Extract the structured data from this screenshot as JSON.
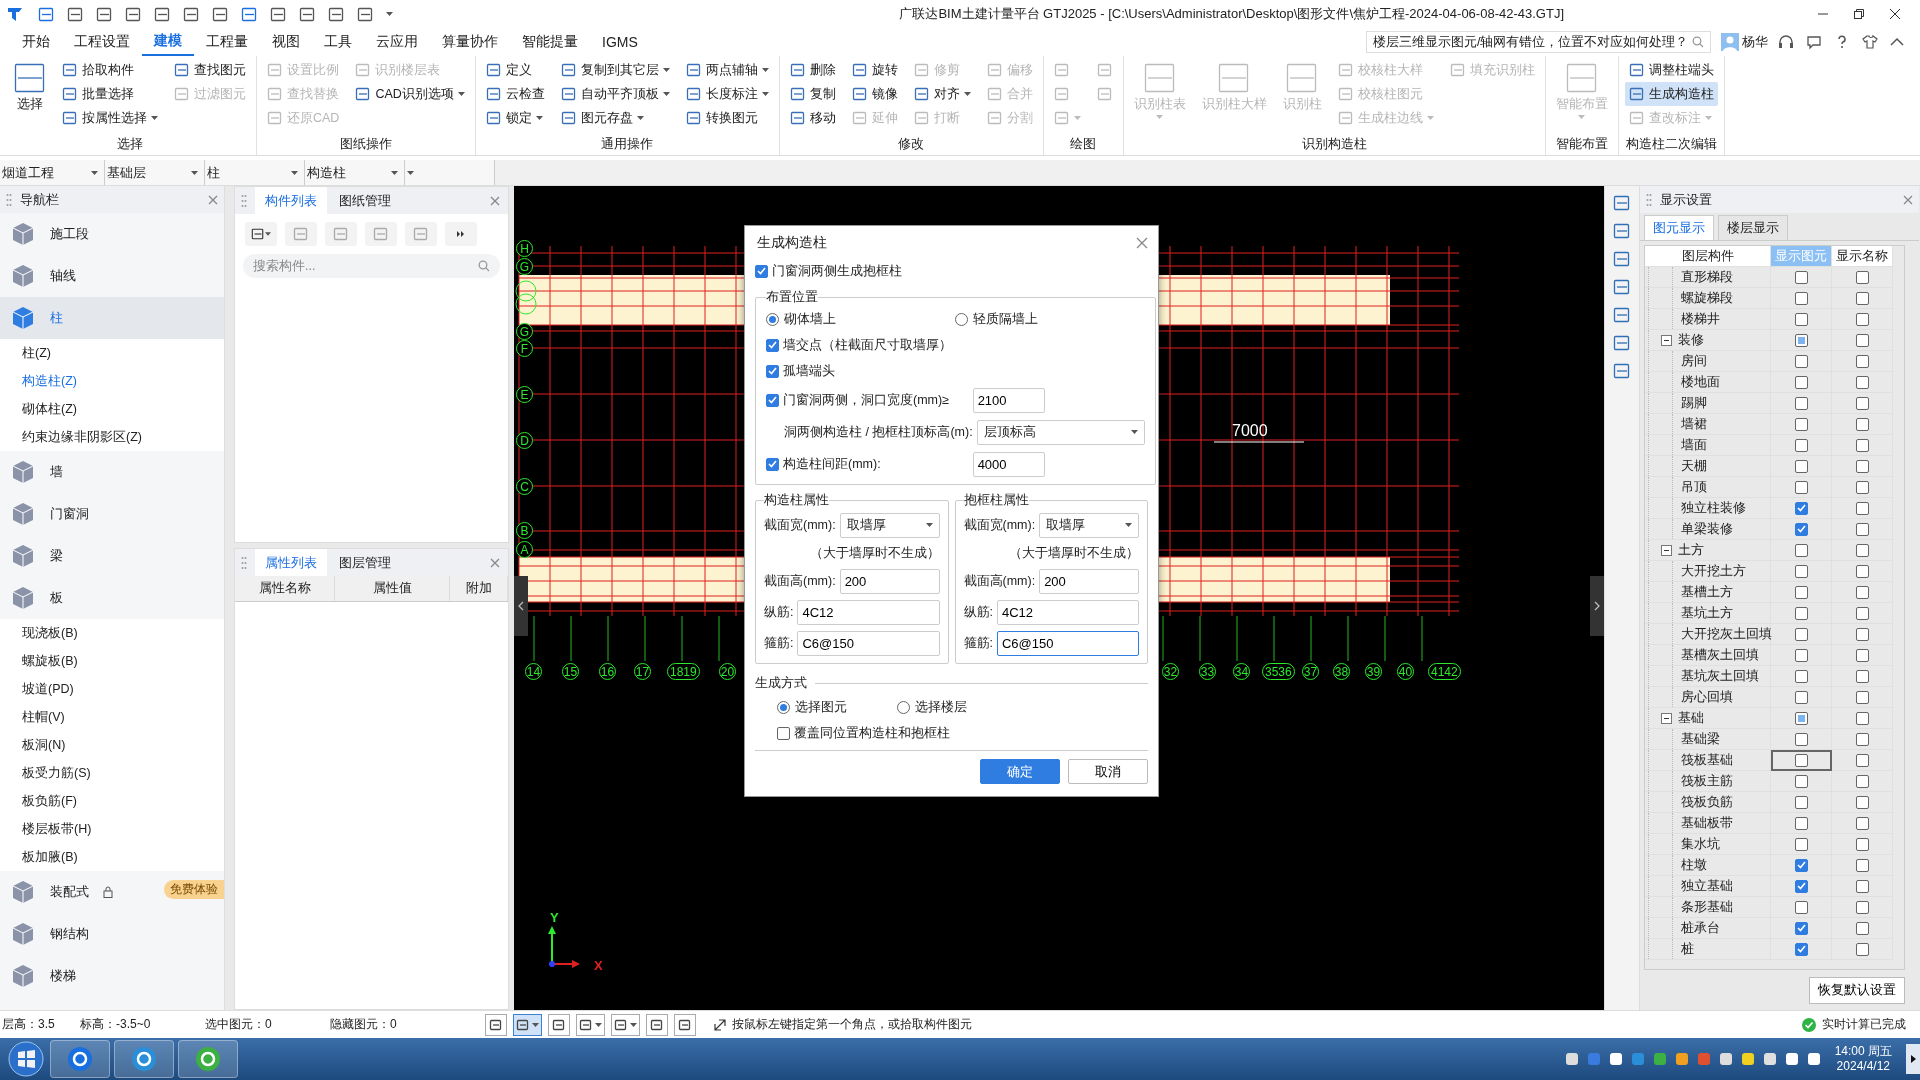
{
  "window": {
    "title": "广联达BIM土建计量平台 GTJ2025 - [C:\\Users\\Administrator\\Desktop\\图形文件\\焦炉工程-2024-04-06-08-42-43.GTJ]"
  },
  "menu": {
    "tabs": [
      {
        "label": "开始",
        "selected": false
      },
      {
        "label": "工程设置",
        "selected": false
      },
      {
        "label": "建模",
        "selected": true
      },
      {
        "label": "工程量",
        "selected": false
      },
      {
        "label": "视图",
        "selected": false
      },
      {
        "label": "工具",
        "selected": false
      },
      {
        "label": "云应用",
        "selected": false
      },
      {
        "label": "算量协作",
        "selected": false
      },
      {
        "label": "智能提量",
        "selected": false
      },
      {
        "label": "IGMS",
        "selected": false
      }
    ],
    "help_search": {
      "placeholder": "楼层三维显示图元/轴网有错位，位置不对应如何处理？"
    },
    "user": "杨华"
  },
  "ribbon": [
    {
      "label": "选择",
      "items": [
        {
          "kind": "big",
          "label": "选择",
          "disabled": false,
          "selected": false,
          "dropdown": false
        },
        {
          "kind": "small",
          "label": "拾取构件",
          "disabled": false,
          "selected": false,
          "dropdown": false
        },
        {
          "kind": "small",
          "label": "批量选择",
          "disabled": false,
          "selected": false,
          "dropdown": false
        },
        {
          "kind": "small",
          "label": "按属性选择",
          "disabled": false,
          "selected": false,
          "dropdown": true
        },
        {
          "kind": "small",
          "label": "查找图元",
          "disabled": false,
          "selected": false,
          "dropdown": false
        },
        {
          "kind": "small",
          "label": "过滤图元",
          "disabled": true,
          "selected": false,
          "dropdown": false
        }
      ]
    },
    {
      "label": "图纸操作",
      "items": [
        {
          "kind": "small",
          "label": "设置比例",
          "disabled": true,
          "selected": false,
          "dropdown": false
        },
        {
          "kind": "small",
          "label": "查找替换",
          "disabled": true,
          "selected": false,
          "dropdown": false
        },
        {
          "kind": "small",
          "label": "还原CAD",
          "disabled": true,
          "selected": false,
          "dropdown": false
        },
        {
          "kind": "small",
          "label": "识别楼层表",
          "disabled": true,
          "selected": false,
          "dropdown": false
        },
        {
          "kind": "small",
          "label": "CAD识别选项",
          "disabled": false,
          "selected": false,
          "dropdown": true
        }
      ]
    },
    {
      "label": "通用操作",
      "items": [
        {
          "kind": "small",
          "label": "定义",
          "disabled": false,
          "selected": false,
          "dropdown": false
        },
        {
          "kind": "small",
          "label": "云检查",
          "disabled": false,
          "selected": false,
          "dropdown": false
        },
        {
          "kind": "small",
          "label": "锁定",
          "disabled": false,
          "selected": false,
          "dropdown": true
        },
        {
          "kind": "small",
          "label": "复制到其它层",
          "disabled": false,
          "selected": false,
          "dropdown": true
        },
        {
          "kind": "small",
          "label": "自动平齐顶板",
          "disabled": false,
          "selected": false,
          "dropdown": true
        },
        {
          "kind": "small",
          "label": "图元存盘",
          "disabled": false,
          "selected": false,
          "dropdown": true
        },
        {
          "kind": "small",
          "label": "两点辅轴",
          "disabled": false,
          "selected": false,
          "dropdown": true
        },
        {
          "kind": "small",
          "label": "长度标注",
          "disabled": false,
          "selected": false,
          "dropdown": true
        },
        {
          "kind": "small",
          "label": "转换图元",
          "disabled": false,
          "selected": false,
          "dropdown": false
        }
      ]
    },
    {
      "label": "修改",
      "items": [
        {
          "kind": "small",
          "label": "删除",
          "disabled": false,
          "selected": false,
          "dropdown": false
        },
        {
          "kind": "small",
          "label": "复制",
          "disabled": false,
          "selected": false,
          "dropdown": false
        },
        {
          "kind": "small",
          "label": "移动",
          "disabled": false,
          "selected": false,
          "dropdown": false
        },
        {
          "kind": "small",
          "label": "旋转",
          "disabled": false,
          "selected": false,
          "dropdown": false
        },
        {
          "kind": "small",
          "label": "镜像",
          "disabled": false,
          "selected": false,
          "dropdown": false
        },
        {
          "kind": "small",
          "label": "延伸",
          "disabled": true,
          "selected": false,
          "dropdown": false
        },
        {
          "kind": "small",
          "label": "修剪",
          "disabled": true,
          "selected": false,
          "dropdown": false
        },
        {
          "kind": "small",
          "label": "对齐",
          "disabled": false,
          "selected": false,
          "dropdown": true
        },
        {
          "kind": "small",
          "label": "打断",
          "disabled": true,
          "selected": false,
          "dropdown": false
        },
        {
          "kind": "small",
          "label": "偏移",
          "disabled": true,
          "selected": false,
          "dropdown": false
        },
        {
          "kind": "small",
          "label": "合并",
          "disabled": true,
          "selected": false,
          "dropdown": false
        },
        {
          "kind": "small",
          "label": "分割",
          "disabled": true,
          "selected": false,
          "dropdown": false
        }
      ]
    },
    {
      "label": "绘图",
      "items": [
        {
          "kind": "icon",
          "disabled": true,
          "selected": false,
          "dropdown": false
        },
        {
          "kind": "icon",
          "disabled": true,
          "selected": false,
          "dropdown": false
        },
        {
          "kind": "icon",
          "disabled": true,
          "selected": false,
          "dropdown": true
        },
        {
          "kind": "icon",
          "disabled": true,
          "selected": false,
          "dropdown": false
        },
        {
          "kind": "icon",
          "disabled": true,
          "selected": false,
          "dropdown": false
        }
      ]
    },
    {
      "label": "识别构造柱",
      "items": [
        {
          "kind": "big",
          "label": "识别柱表",
          "disabled": true,
          "selected": false,
          "dropdown": true
        },
        {
          "kind": "big",
          "label": "识别柱大样",
          "disabled": true,
          "selected": false,
          "dropdown": false
        },
        {
          "kind": "big",
          "label": "识别柱",
          "disabled": true,
          "selected": false,
          "dropdown": false
        },
        {
          "kind": "small",
          "label": "校核柱大样",
          "disabled": true,
          "selected": false,
          "dropdown": false
        },
        {
          "kind": "small",
          "label": "校核柱图元",
          "disabled": true,
          "selected": false,
          "dropdown": false
        },
        {
          "kind": "small",
          "label": "生成柱边线",
          "disabled": true,
          "selected": false,
          "dropdown": true
        },
        {
          "kind": "small",
          "label": "填充识别柱",
          "disabled": true,
          "selected": false,
          "dropdown": false
        }
      ]
    },
    {
      "label": "智能布置",
      "items": [
        {
          "kind": "big",
          "label": "智能布置",
          "disabled": true,
          "selected": false,
          "dropdown": true
        }
      ]
    },
    {
      "label": "构造柱二次编辑",
      "items": [
        {
          "kind": "small",
          "label": "调整柱端头",
          "disabled": false,
          "selected": false,
          "dropdown": false
        },
        {
          "kind": "small",
          "label": "生成构造柱",
          "disabled": false,
          "selected": true,
          "dropdown": false
        },
        {
          "kind": "small",
          "label": "查改标注",
          "disabled": true,
          "selected": false,
          "dropdown": true
        }
      ]
    }
  ],
  "selectors": [
    {
      "value": "烟道工程"
    },
    {
      "value": "基础层"
    },
    {
      "value": "柱"
    },
    {
      "value": "构造柱"
    }
  ],
  "navigator": {
    "title": "导航栏",
    "items": [
      {
        "label": "施工段",
        "selected": false,
        "locked": false
      },
      {
        "label": "轴线",
        "selected": false,
        "locked": false
      },
      {
        "label": "柱",
        "selected": true,
        "locked": false,
        "children": [
          {
            "label": "柱(Z)",
            "selected": false
          },
          {
            "label": "构造柱(Z)",
            "selected": true
          },
          {
            "label": "砌体柱(Z)",
            "selected": false
          },
          {
            "label": "约束边缘非阴影区(Z)",
            "selected": false
          }
        ]
      },
      {
        "label": "墙",
        "selected": false,
        "locked": false
      },
      {
        "label": "门窗洞",
        "selected": false,
        "locked": false
      },
      {
        "label": "梁",
        "selected": false,
        "locked": false
      },
      {
        "label": "板",
        "selected": false,
        "locked": false,
        "children": [
          {
            "label": "现浇板(B)",
            "selected": false
          },
          {
            "label": "螺旋板(B)",
            "selected": false
          },
          {
            "label": "坡道(PD)",
            "selected": false
          },
          {
            "label": "柱帽(V)",
            "selected": false
          },
          {
            "label": "板洞(N)",
            "selected": false
          },
          {
            "label": "板受力筋(S)",
            "selected": false
          },
          {
            "label": "板负筋(F)",
            "selected": false
          },
          {
            "label": "楼层板带(H)",
            "selected": false
          },
          {
            "label": "板加腋(B)",
            "selected": false
          }
        ]
      },
      {
        "label": "装配式",
        "selected": false,
        "locked": true,
        "badge": "免费体验"
      },
      {
        "label": "钢结构",
        "selected": false,
        "locked": false
      },
      {
        "label": "楼梯",
        "selected": false,
        "locked": false
      }
    ]
  },
  "component_panel": {
    "tabs": [
      {
        "label": "构件列表",
        "selected": true
      },
      {
        "label": "图纸管理",
        "selected": false
      }
    ],
    "search": {
      "placeholder": "搜索构件..."
    }
  },
  "property_panel": {
    "tabs": [
      {
        "label": "属性列表",
        "selected": true
      },
      {
        "label": "图层管理",
        "selected": false
      }
    ],
    "columns": [
      "属性名称",
      "属性值",
      "附加"
    ]
  },
  "canvas": {
    "row_axes": [
      "H",
      "G",
      "G",
      "F",
      "E",
      "D",
      "C",
      "B",
      "A"
    ],
    "column_axes": [
      "14",
      "15",
      "16",
      "17",
      "1819",
      "20",
      "32",
      "33",
      "34",
      "3536",
      "37",
      "38",
      "39",
      "40",
      "4142"
    ],
    "dimension": "7000",
    "axis_labels": [
      "Y",
      "X"
    ]
  },
  "dialog": {
    "title": "生成构造柱",
    "frame_columns": {
      "label": "门窗洞两侧生成抱框柱",
      "checked": true
    },
    "placement": {
      "legend": "布置位置",
      "options": [
        {
          "label": "砌体墙上",
          "selected": true
        },
        {
          "label": "轻质隔墙上",
          "selected": false
        }
      ],
      "checks": [
        {
          "label": "墙交点（柱截面尺寸取墙厚）",
          "checked": true
        },
        {
          "label": "孤墙端头",
          "checked": true
        }
      ],
      "opening": {
        "label": "门窗洞两侧，洞口宽度(mm)≥",
        "checked": true,
        "value": "2100"
      },
      "top_elevation": {
        "label": "洞两侧构造柱 / 抱框柱顶标高(m):",
        "value": "层顶标高"
      },
      "spacing": {
        "label": "构造柱间距(mm):",
        "checked": true,
        "value": "4000"
      }
    },
    "properties": [
      {
        "legend": "构造柱属性",
        "width_label": "截面宽(mm):",
        "width_value": "取墙厚",
        "note": "（大于墙厚时不生成）",
        "height_label": "截面高(mm):",
        "height_value": "200",
        "long_label": "纵筋:",
        "long_value": "4C12",
        "stirrup_label": "箍筋:",
        "stirrup_value": "C6@150",
        "stirrup_focused": false
      },
      {
        "legend": "抱框柱属性",
        "width_label": "截面宽(mm):",
        "width_value": "取墙厚",
        "note": "（大于墙厚时不生成）",
        "height_label": "截面高(mm):",
        "height_value": "200",
        "long_label": "纵筋:",
        "long_value": "4C12",
        "stirrup_label": "箍筋:",
        "stirrup_value": "C6@150",
        "stirrup_focused": true
      }
    ],
    "method": {
      "legend": "生成方式",
      "options": [
        {
          "label": "选择图元",
          "selected": true
        },
        {
          "label": "选择楼层",
          "selected": false
        }
      ],
      "overwrite": {
        "label": "覆盖同位置构造柱和抱框柱",
        "checked": false
      }
    },
    "buttons": [
      {
        "label": "确定",
        "kind": "primary"
      },
      {
        "label": "取消",
        "kind": "secondary"
      }
    ]
  },
  "display_settings": {
    "title": "显示设置",
    "tabs": [
      {
        "label": "图元显示",
        "selected": true
      },
      {
        "label": "楼层显示",
        "selected": false
      }
    ],
    "columns": [
      {
        "label": "图层构件",
        "highlighted": false
      },
      {
        "label": "显示图元",
        "highlighted": true
      },
      {
        "label": "显示名称",
        "highlighted": false
      }
    ],
    "rows": [
      {
        "children": [
          {
            "label": "直形梯段",
            "show": false,
            "partial": false,
            "show_name": false,
            "focused": false
          },
          {
            "label": "螺旋梯段",
            "show": false,
            "partial": false,
            "show_name": false,
            "focused": false
          },
          {
            "label": "楼梯井",
            "show": false,
            "partial": false,
            "show_name": false,
            "focused": false
          }
        ]
      },
      {
        "label": "装修",
        "expanded": true,
        "show": false,
        "partial": true,
        "show_name": false,
        "focused": false,
        "children": [
          {
            "label": "房间",
            "show": false,
            "partial": false,
            "show_name": false,
            "focused": false
          },
          {
            "label": "楼地面",
            "show": false,
            "partial": false,
            "show_name": false,
            "focused": false
          },
          {
            "label": "踢脚",
            "show": false,
            "partial": false,
            "show_name": false,
            "focused": false
          },
          {
            "label": "墙裙",
            "show": false,
            "partial": false,
            "show_name": false,
            "focused": false
          },
          {
            "label": "墙面",
            "show": false,
            "partial": false,
            "show_name": false,
            "focused": false
          },
          {
            "label": "天棚",
            "show": false,
            "partial": false,
            "show_name": false,
            "focused": false
          },
          {
            "label": "吊顶",
            "show": false,
            "partial": false,
            "show_name": false,
            "focused": false
          },
          {
            "label": "独立柱装修",
            "show": true,
            "partial": false,
            "show_name": false,
            "focused": false
          },
          {
            "label": "单梁装修",
            "show": true,
            "partial": false,
            "show_name": false,
            "focused": false
          }
        ]
      },
      {
        "label": "土方",
        "expanded": true,
        "show": false,
        "partial": false,
        "show_name": false,
        "focused": false,
        "children": [
          {
            "label": "大开挖土方",
            "show": false,
            "partial": false,
            "show_name": false,
            "focused": false
          },
          {
            "label": "基槽土方",
            "show": false,
            "partial": false,
            "show_name": false,
            "focused": false
          },
          {
            "label": "基坑土方",
            "show": false,
            "partial": false,
            "show_name": false,
            "focused": false
          },
          {
            "label": "大开挖灰土回填",
            "show": false,
            "partial": false,
            "show_name": false,
            "focused": false
          },
          {
            "label": "基槽灰土回填",
            "show": false,
            "partial": false,
            "show_name": false,
            "focused": false
          },
          {
            "label": "基坑灰土回填",
            "show": false,
            "partial": false,
            "show_name": false,
            "focused": false
          },
          {
            "label": "房心回填",
            "show": false,
            "partial": false,
            "show_name": false,
            "focused": false
          }
        ]
      },
      {
        "label": "基础",
        "expanded": true,
        "show": false,
        "partial": true,
        "show_name": false,
        "focused": false,
        "children": [
          {
            "label": "基础梁",
            "show": false,
            "partial": false,
            "show_name": false,
            "focused": false
          },
          {
            "label": "筏板基础",
            "show": false,
            "partial": false,
            "show_name": false,
            "focused": true
          },
          {
            "label": "筏板主筋",
            "show": false,
            "partial": false,
            "show_name": false,
            "focused": false
          },
          {
            "label": "筏板负筋",
            "show": false,
            "partial": false,
            "show_name": false,
            "focused": false
          },
          {
            "label": "基础板带",
            "show": false,
            "partial": false,
            "show_name": false,
            "focused": false
          },
          {
            "label": "集水坑",
            "show": false,
            "partial": false,
            "show_name": false,
            "focused": false
          },
          {
            "label": "柱墩",
            "show": true,
            "partial": false,
            "show_name": false,
            "focused": false
          },
          {
            "label": "独立基础",
            "show": true,
            "partial": false,
            "show_name": false,
            "focused": false
          },
          {
            "label": "条形基础",
            "show": false,
            "partial": false,
            "show_name": false,
            "focused": false
          },
          {
            "label": "桩承台",
            "show": true,
            "partial": false,
            "show_name": false,
            "focused": false
          },
          {
            "label": "桩",
            "show": true,
            "partial": false,
            "show_name": false,
            "focused": false
          }
        ]
      }
    ],
    "reset_button": "恢复默认设置"
  },
  "status_bar": {
    "fields": [
      "层高：3.5",
      "标高：-3.5~0",
      "选中图元：0",
      "隐藏图元：0"
    ],
    "tools": [
      {
        "selected": false,
        "dropdown": false
      },
      {
        "selected": true,
        "dropdown": true
      },
      {
        "selected": false,
        "dropdown": false
      },
      {
        "selected": false,
        "dropdown": true
      },
      {
        "selected": false,
        "dropdown": true
      },
      {
        "selected": false,
        "dropdown": false
      },
      {
        "selected": false,
        "dropdown": false
      }
    ],
    "hint": "按鼠标左键指定第一个角点，或拾取构件图元",
    "calc_status": "实时计算已完成"
  },
  "taskbar": {
    "time": "14:00 周五",
    "date": "2024/4/12"
  }
}
